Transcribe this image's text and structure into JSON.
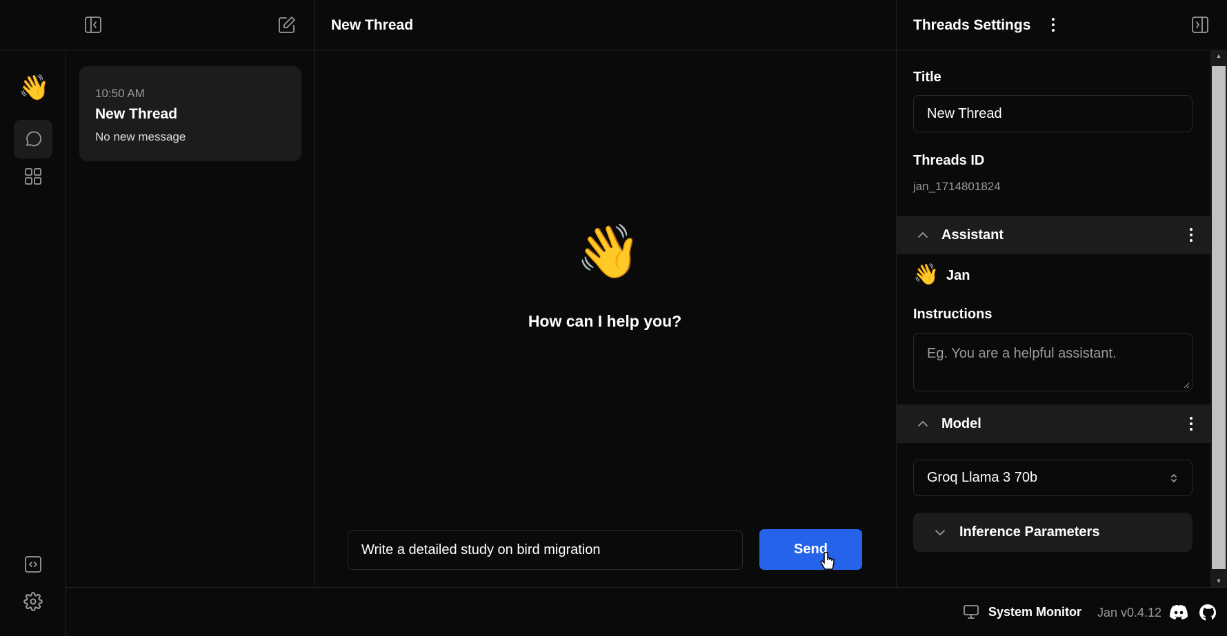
{
  "header": {
    "thread_title": "New Thread",
    "settings_title": "Threads Settings"
  },
  "threads": [
    {
      "time": "10:50 AM",
      "title": "New Thread",
      "preview": "No new message"
    }
  ],
  "main": {
    "emoji": "👋",
    "greeting": "How can I help you?",
    "input_value": "Write a detailed study on bird migration",
    "send_label": "Send"
  },
  "settings": {
    "title_label": "Title",
    "title_value": "New Thread",
    "id_label": "Threads ID",
    "id_value": "jan_1714801824",
    "assistant_section": "Assistant",
    "assistant_emoji": "👋",
    "assistant_name": "Jan",
    "instructions_label": "Instructions",
    "instructions_placeholder": "Eg. You are a helpful assistant.",
    "model_section": "Model",
    "model_value": "Groq Llama 3 70b",
    "inference_label": "Inference Parameters"
  },
  "footer": {
    "system_monitor": "System Monitor",
    "version": "Jan v0.4.12"
  },
  "colors": {
    "accent": "#2563eb",
    "background": "#0a0a0a",
    "panel": "#1c1c1c"
  }
}
